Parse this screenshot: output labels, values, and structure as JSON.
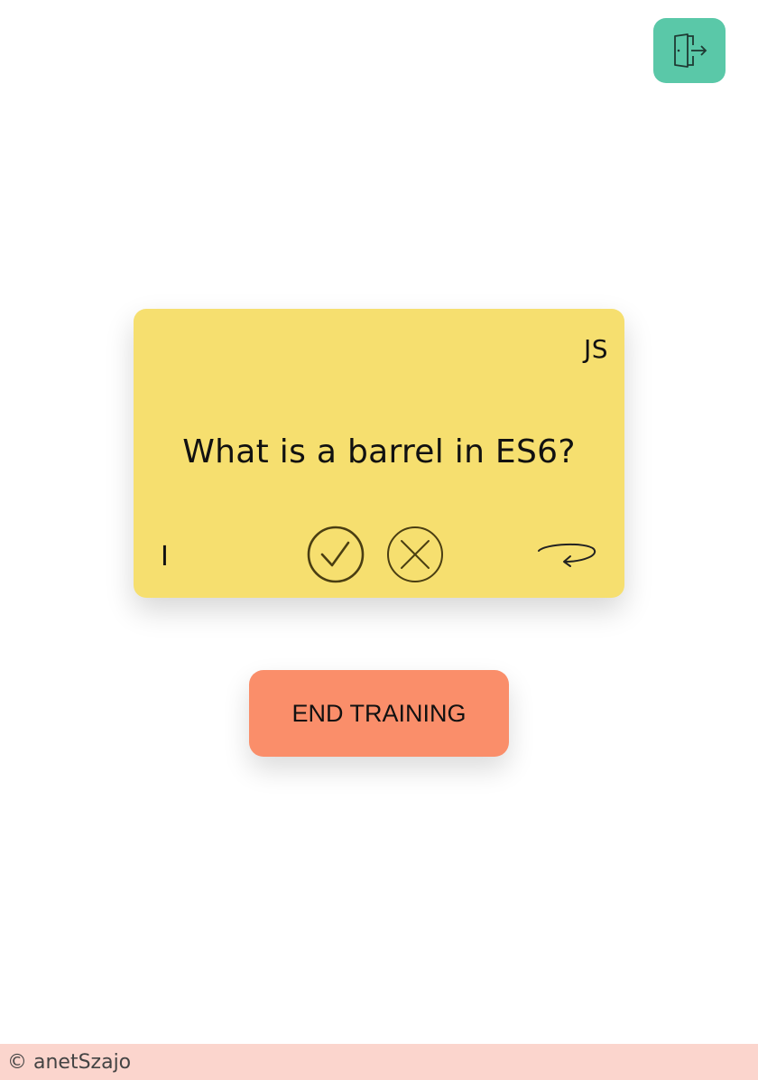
{
  "colors": {
    "logout_bg": "#5ac8a8",
    "card_bg": "#f6df6f",
    "end_button_bg": "#fa8e6a",
    "footer_bg": "#fbd5cd",
    "icon_stroke": "#4a3e12"
  },
  "header": {
    "logout_icon": "logout-door-icon"
  },
  "card": {
    "category": "JS",
    "question": "What is a barrel in ES6?",
    "side_indicator": "I",
    "icons": {
      "correct": "check-circle-icon",
      "wrong": "x-circle-icon",
      "flip": "flip-arrow-icon"
    }
  },
  "actions": {
    "end_training_label": "END TRAINING"
  },
  "footer": {
    "copyright": "© anetSzajo"
  }
}
